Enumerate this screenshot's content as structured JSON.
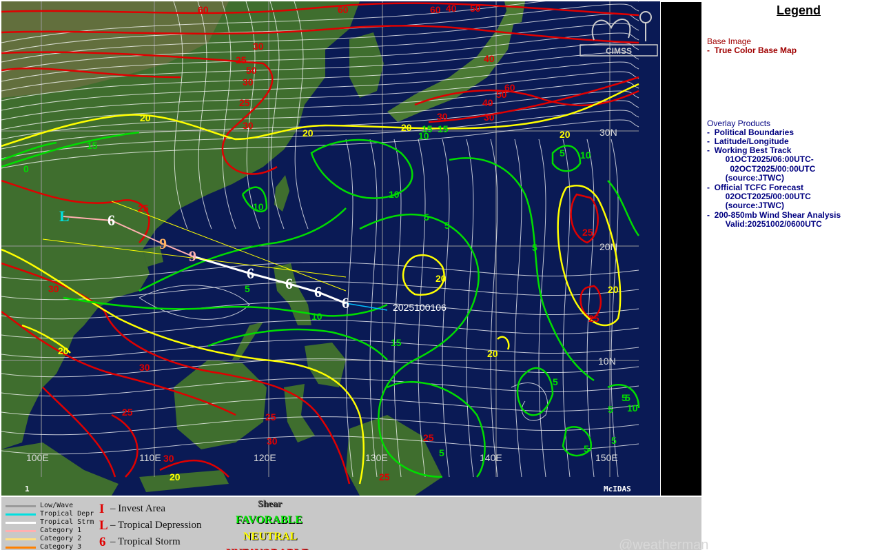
{
  "colors": {
    "ocean": "#0a1a55",
    "land": "#3f6e2e",
    "land_dry": "#7a7048",
    "streamline": "#ffffff",
    "contour_red": "#e00000",
    "contour_yellow": "#ffff00",
    "contour_green": "#00dd00",
    "graticule": "#9a9a9a",
    "legend_red": "#a00000",
    "legend_blue": "#000080"
  },
  "map": {
    "frame_number": "1",
    "watermark": "McIDAS",
    "logo_text": "CIMSS",
    "lat_labels": [
      "30N",
      "20N",
      "10N"
    ],
    "lon_labels": [
      "100E",
      "110E",
      "120E",
      "130E",
      "140E",
      "150E"
    ],
    "track_time_label": "2025100106",
    "contour_labels": {
      "red": [
        "60",
        "60",
        "60",
        "40",
        "50",
        "30",
        "50",
        "40",
        "30",
        "25",
        "30",
        "30",
        "25",
        "30",
        "60",
        "50",
        "40",
        "25",
        "25",
        "30",
        "25",
        "25",
        "30",
        "30",
        "25",
        "25",
        "30",
        "25"
      ],
      "yellow": [
        "20",
        "20",
        "20",
        "20",
        "20",
        "20",
        "20",
        "20",
        "20"
      ],
      "green": [
        "15",
        "15",
        "10",
        "10",
        "10",
        "10",
        "5",
        "5",
        "5",
        "5",
        "5",
        "5",
        "5",
        "5",
        "5",
        "5",
        "10",
        "5",
        "15",
        "10",
        "5",
        "0",
        "15"
      ]
    }
  },
  "legend": {
    "title": "Legend",
    "lines": [
      {
        "text": "Base Image",
        "style": "red"
      },
      {
        "text": "-  True Color Base Map",
        "style": "red"
      },
      {
        "text": "Overlay Products",
        "style": "blue"
      },
      {
        "text": "-  Political Boundaries",
        "style": "blue"
      },
      {
        "text": "-  Latitude/Longitude",
        "style": "blue"
      },
      {
        "text": "-  Working Best Track",
        "style": "blue"
      },
      {
        "text": "        01OCT2025/06:00UTC-",
        "style": "blue"
      },
      {
        "text": "          02OCT2025/00:00UTC",
        "style": "blue"
      },
      {
        "text": "        (source:JTWC)",
        "style": "blue"
      },
      {
        "text": "-  Official TCFC Forecast",
        "style": "blue"
      },
      {
        "text": "        02OCT2025/00:00UTC",
        "style": "blue"
      },
      {
        "text": "        (source:JTWC)",
        "style": "blue"
      },
      {
        "text": "-  200-850mb Wind Shear Analysis",
        "style": "blue"
      },
      {
        "text": "        Valid:20251002/0600UTC",
        "style": "blue"
      }
    ]
  },
  "key": {
    "track_lines": [
      {
        "label": "Low/Wave",
        "color": "#9a9a9a"
      },
      {
        "label": "Tropical Depr",
        "color": "#00e0e0"
      },
      {
        "label": "Tropical Strm",
        "color": "#ffffff"
      },
      {
        "label": "Category 1",
        "color": "#ffb0b0"
      },
      {
        "label": "Category 2",
        "color": "#ffe080"
      },
      {
        "label": "Category 3",
        "color": "#ff8000"
      }
    ],
    "symbols": [
      {
        "glyph": "I",
        "label": "– Invest Area",
        "color": "#e00000"
      },
      {
        "glyph": "L",
        "label": "– Tropical Depression",
        "color": "#e00000"
      },
      {
        "glyph": "6",
        "label": "– Tropical Storm",
        "color": "#e00000"
      }
    ],
    "shear_title": "Shear",
    "shear": [
      {
        "label": "FAVORABLE",
        "color": "#00ee00"
      },
      {
        "label": "NEUTRAL",
        "color": "#ffff00"
      },
      {
        "label": "UNFAVORABLE",
        "color": "#ee0000"
      }
    ]
  },
  "credit": "@weatherman_"
}
